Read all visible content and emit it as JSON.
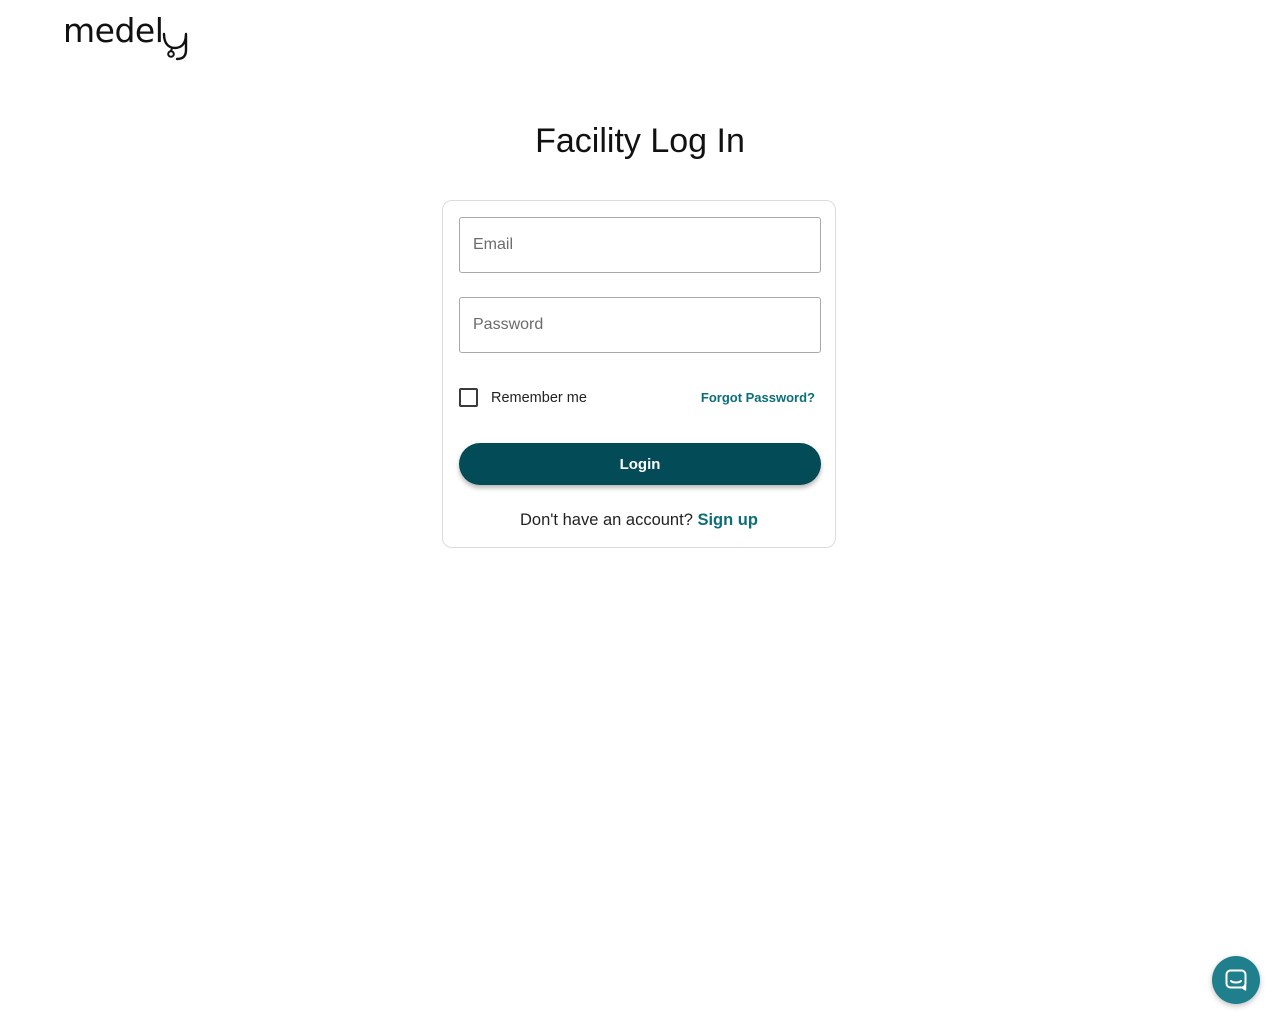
{
  "brand": {
    "logo_text": "medely",
    "logo_text_display": "medel"
  },
  "page": {
    "title": "Facility Log In"
  },
  "form": {
    "email_placeholder": "Email",
    "email_value": "",
    "password_placeholder": "Password",
    "password_value": "",
    "remember_label": "Remember me",
    "remember_checked": false,
    "forgot_link": "Forgot Password?",
    "login_button": "Login",
    "signup_prompt": "Don't have an account?",
    "signup_link": "Sign up"
  },
  "chat": {
    "icon": "chat-bubble-icon"
  },
  "colors": {
    "primary": "#034b57",
    "link": "#0b6e78",
    "chat": "#1f7f8c",
    "border": "#dcdcdc"
  }
}
